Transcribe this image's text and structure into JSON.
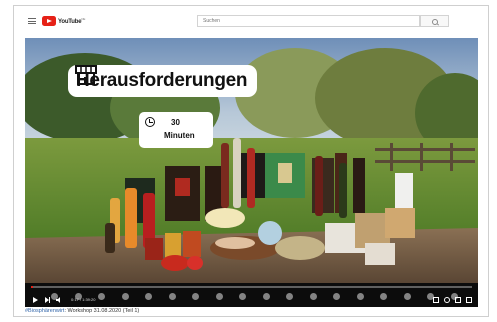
{
  "app": {
    "logo_text": "YouTube",
    "logo_superscript": "DE"
  },
  "search": {
    "placeholder": "Suchen"
  },
  "video": {
    "title_overlay": "Herausforderungen",
    "duration_value": "30",
    "duration_unit": "Minuten",
    "time_display": "0:17 / 1:39:20",
    "progress": 0.005,
    "chapter_marker_count": 18
  },
  "caption": {
    "hashtag": "#Biosphärenwirt",
    "text": ": Workshop 31.08.2020 (Teil 1)"
  },
  "colors": {
    "brand_red": "#e62117",
    "link_blue": "#3366aa"
  },
  "icons": [
    "menu-icon",
    "search-icon",
    "store-icon",
    "alarm-clock-icon",
    "play-icon",
    "next-icon",
    "volume-icon",
    "subtitles-icon",
    "settings-icon",
    "miniplayer-icon",
    "fullscreen-icon"
  ]
}
